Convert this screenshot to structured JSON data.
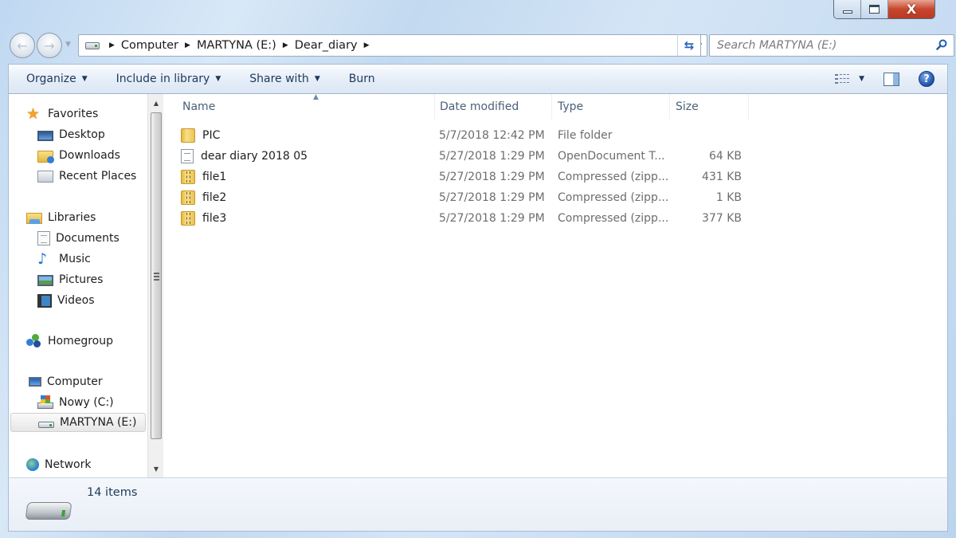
{
  "window": {
    "caption_buttons": {
      "minimize": "minimize",
      "maximize": "maximize",
      "close": "X"
    }
  },
  "address_bar": {
    "breadcrumb": [
      "Computer",
      "MARTYNA (E:)",
      "Dear_diary"
    ],
    "drive_icon": "removable-drive-icon"
  },
  "search": {
    "placeholder": "Search MARTYNA (E:)",
    "value": ""
  },
  "toolbar": {
    "organize": "Organize",
    "include_in_library": "Include in library",
    "share_with": "Share with",
    "burn": "Burn"
  },
  "nav_pane": {
    "favorites": {
      "label": "Favorites",
      "items": [
        "Desktop",
        "Downloads",
        "Recent Places"
      ]
    },
    "libraries": {
      "label": "Libraries",
      "items": [
        "Documents",
        "Music",
        "Pictures",
        "Videos"
      ]
    },
    "homegroup": "Homegroup",
    "computer": {
      "label": "Computer",
      "items": [
        "Nowy (C:)",
        "MARTYNA (E:)"
      ]
    },
    "selected": "MARTYNA (E:)",
    "network": "Network"
  },
  "file_list": {
    "columns": {
      "name": "Name",
      "date": "Date modified",
      "type": "Type",
      "size": "Size"
    },
    "sorted_by": "Name",
    "rows": [
      {
        "name": "PIC",
        "date": "5/7/2018 12:42 PM",
        "type": "File folder",
        "size": "",
        "icon": "folder"
      },
      {
        "name": "dear diary 2018 05",
        "date": "5/27/2018 1:29 PM",
        "type": "OpenDocument T...",
        "size": "64 KB",
        "icon": "doc"
      },
      {
        "name": "file1",
        "date": "5/27/2018 1:29 PM",
        "type": "Compressed (zipp...",
        "size": "431 KB",
        "icon": "zip"
      },
      {
        "name": "file2",
        "date": "5/27/2018 1:29 PM",
        "type": "Compressed (zipp...",
        "size": "1 KB",
        "icon": "zip"
      },
      {
        "name": "file3",
        "date": "5/27/2018 1:29 PM",
        "type": "Compressed (zipp...",
        "size": "377 KB",
        "icon": "zip"
      }
    ]
  },
  "status_bar": {
    "item_count": "14 items"
  },
  "icons": {
    "sort": "▲",
    "caret": "▼",
    "breadcrumb_sep": "▶",
    "refresh": "⇆",
    "back": "←",
    "forward": "→",
    "help": "?"
  }
}
